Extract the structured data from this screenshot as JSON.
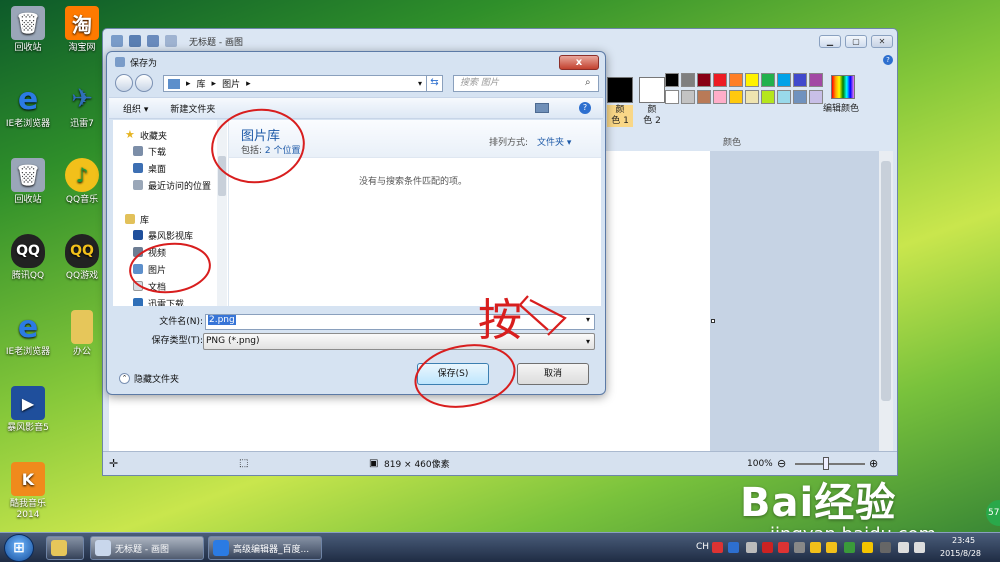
{
  "desktop": {
    "icons": [
      {
        "label": "回收站",
        "icon": "recycle-bin-icon",
        "color": "#9aa6b8"
      },
      {
        "label": "淘宝网",
        "icon": "taobao-icon",
        "color": "#ff7a00"
      },
      {
        "label": "IE老浏览器",
        "icon": "ie-icon",
        "color": "#2b7be3"
      },
      {
        "label": "迅雷7",
        "icon": "thunder-icon",
        "color": "#2f6fb8"
      },
      {
        "label": "回收站",
        "icon": "recycle-bin-icon",
        "color": "#9aa6b8"
      },
      {
        "label": "QQ音乐",
        "icon": "qq-music-icon",
        "color": "#f2c01a"
      },
      {
        "label": "腾讯QQ",
        "icon": "qq-icon",
        "color": "#222222"
      },
      {
        "label": "QQ游戏",
        "icon": "qq-game-icon",
        "color": "#222222"
      },
      {
        "label": "IE老浏览器",
        "icon": "ie-icon",
        "color": "#2b7be3"
      },
      {
        "label": "办公",
        "icon": "folder-icon",
        "color": "#e6c65a"
      },
      {
        "label": "暴风影音5",
        "icon": "baofeng-icon",
        "color": "#1f4f9c"
      },
      {
        "label": "酷我音乐\n2014",
        "icon": "kuwo-icon",
        "color": "#f08a1c"
      }
    ]
  },
  "paint": {
    "title": "无标题 - 画图",
    "color1_label": "颜\n色 1",
    "color2_label": "颜\n色 2",
    "edit_colors_label": "编辑颜色",
    "colors_group_label": "颜色",
    "status": {
      "size": "819 × 460像素",
      "zoom": "100%"
    },
    "palette": [
      "#000000",
      "#7f7f7f",
      "#880015",
      "#ed1c24",
      "#ff7f27",
      "#fff200",
      "#22b14c",
      "#00a2e8",
      "#3f48cc",
      "#a349a4",
      "#ffffff",
      "#c3c3c3",
      "#b97a57",
      "#ffaec9",
      "#ffc90e",
      "#efe4b0",
      "#b5e61d",
      "#99d9ea",
      "#7092be",
      "#c8bfe7"
    ]
  },
  "dialog": {
    "title": "保存为",
    "close_label": "x",
    "breadcrumb": [
      "库",
      "图片"
    ],
    "search_placeholder": "搜索 图片",
    "toolbar": {
      "organize": "组织 ▾",
      "new_folder": "新建文件夹"
    },
    "nav": {
      "favorites": "收藏夹",
      "downloads": "下载",
      "desktop": "桌面",
      "recent": "最近访问的位置",
      "libraries": "库",
      "baofeng": "暴风影视库",
      "videos": "视频",
      "pictures": "图片",
      "documents": "文档",
      "thunder": "迅雷下载"
    },
    "library": {
      "title": "图片库",
      "includes_label": "包括:",
      "locations": "2 个位置",
      "sort_label": "排列方式:",
      "sort_value": "文件夹 ▾",
      "empty_message": "没有与搜索条件匹配的项。"
    },
    "filename_label": "文件名(N):",
    "filename_value": "2.png",
    "filetype_label": "保存类型(T):",
    "filetype_value": "PNG (*.png)",
    "hide_folders": "隐藏文件夹",
    "save_button": "保存(S)",
    "cancel_button": "取消"
  },
  "taskbar": {
    "items": [
      {
        "label": "无标题 - 画图",
        "icon": "paint-icon"
      },
      {
        "label": "高级编辑器_百度...",
        "icon": "ie-icon"
      }
    ],
    "ime": "CH",
    "time": "23:45",
    "date": "2015/8/28"
  },
  "watermark": {
    "main": "Bai经验",
    "url": "jingyan.baidu.com"
  },
  "annotation": {
    "text": "按"
  }
}
